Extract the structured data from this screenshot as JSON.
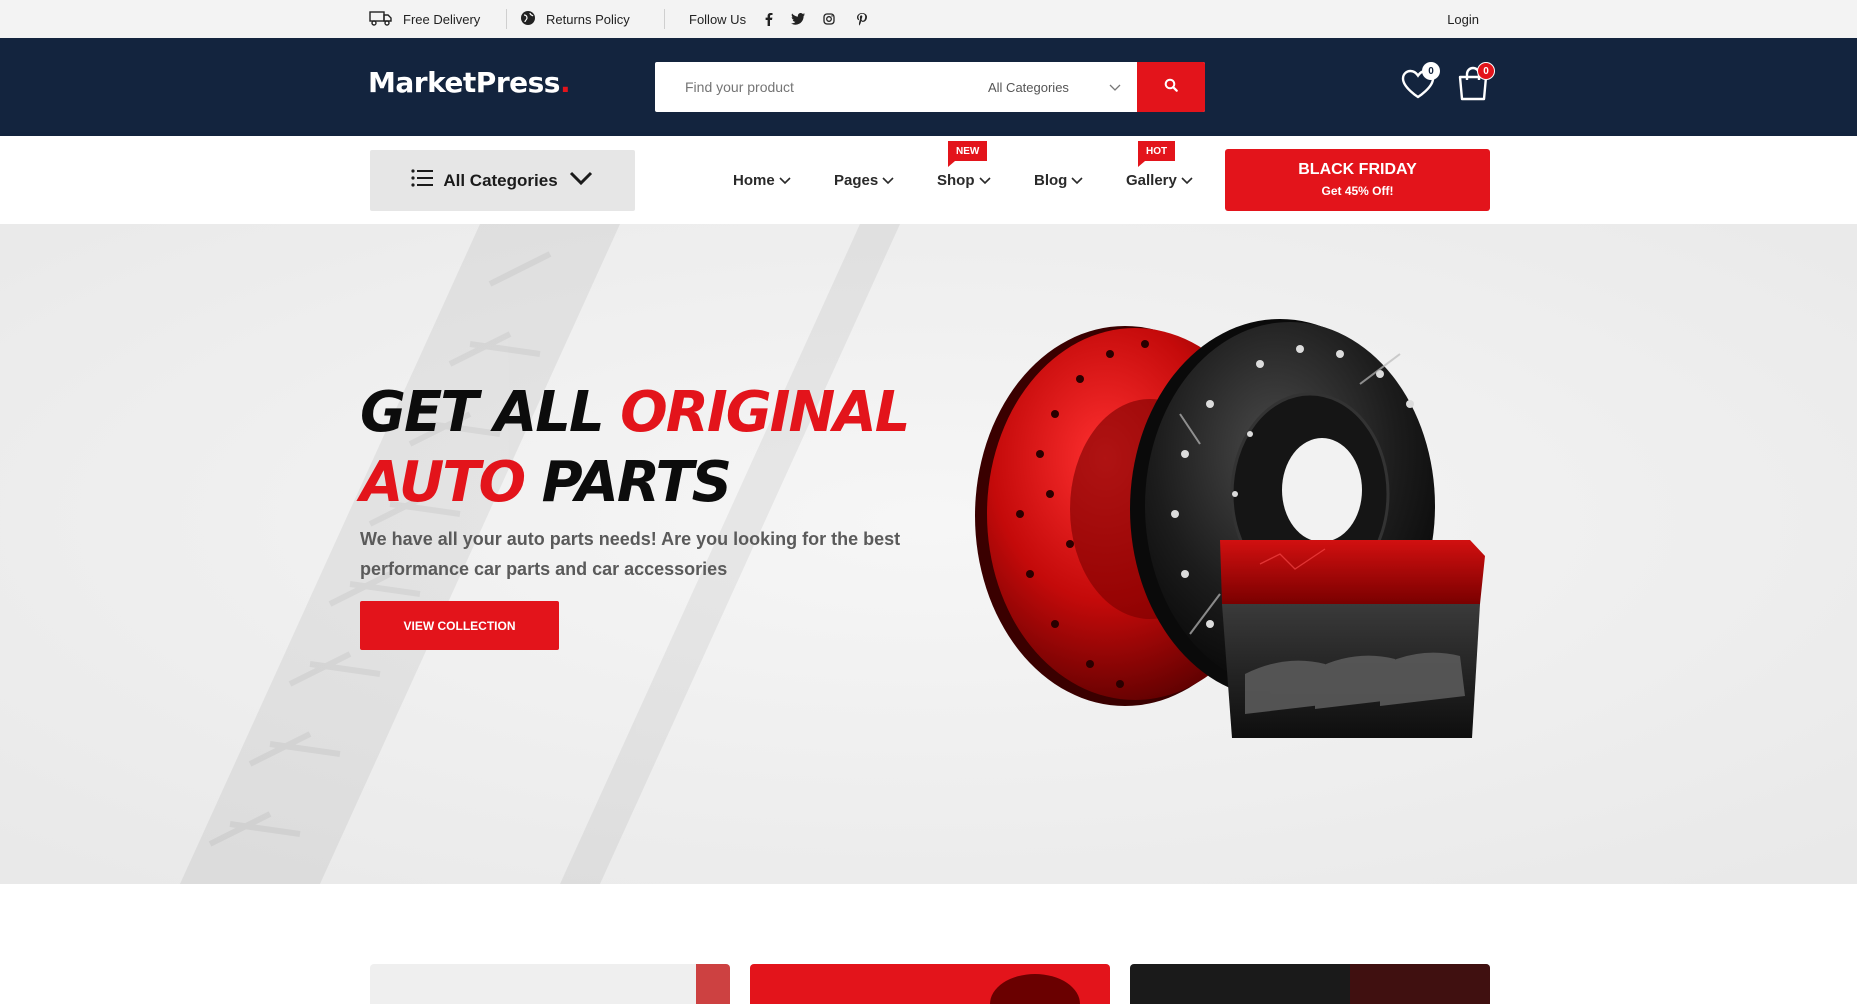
{
  "topbar": {
    "delivery_label": "Free Delivery",
    "returns_label": "Returns Policy",
    "follow_label": "Follow Us",
    "social_icons": [
      "facebook-icon",
      "twitter-icon",
      "instagram-icon",
      "pinterest-icon"
    ],
    "login_label": "Login"
  },
  "header": {
    "logo_text": "MarketPress",
    "logo_dot": ".",
    "search_placeholder": "Find your product",
    "search_category": "All Categories",
    "wishlist_count": "0",
    "cart_count": "0"
  },
  "nav": {
    "all_categories_label": "All Categories",
    "items": [
      {
        "label": "Home",
        "tag": ""
      },
      {
        "label": "Pages",
        "tag": ""
      },
      {
        "label": "Shop",
        "tag": "NEW"
      },
      {
        "label": "Blog",
        "tag": ""
      },
      {
        "label": "Gallery",
        "tag": "HOT"
      }
    ],
    "promo_title": "BLACK FRIDAY",
    "promo_subtitle": "Get 45% Off!"
  },
  "hero": {
    "title_black_1": "GET ALL ",
    "title_red_1": "ORIGINAL",
    "title_red_2": "AUTO",
    "title_black_2": " PARTS",
    "subtitle": "We have all your auto parts needs! Are you looking for the best performance car parts and car accessories",
    "cta_label": "VIEW COLLECTION"
  },
  "colors": {
    "accent": "#e3141b",
    "header_bg": "#13243e",
    "topbar_bg": "#f3f3f3",
    "hero_bg": "#f0f0f0"
  }
}
